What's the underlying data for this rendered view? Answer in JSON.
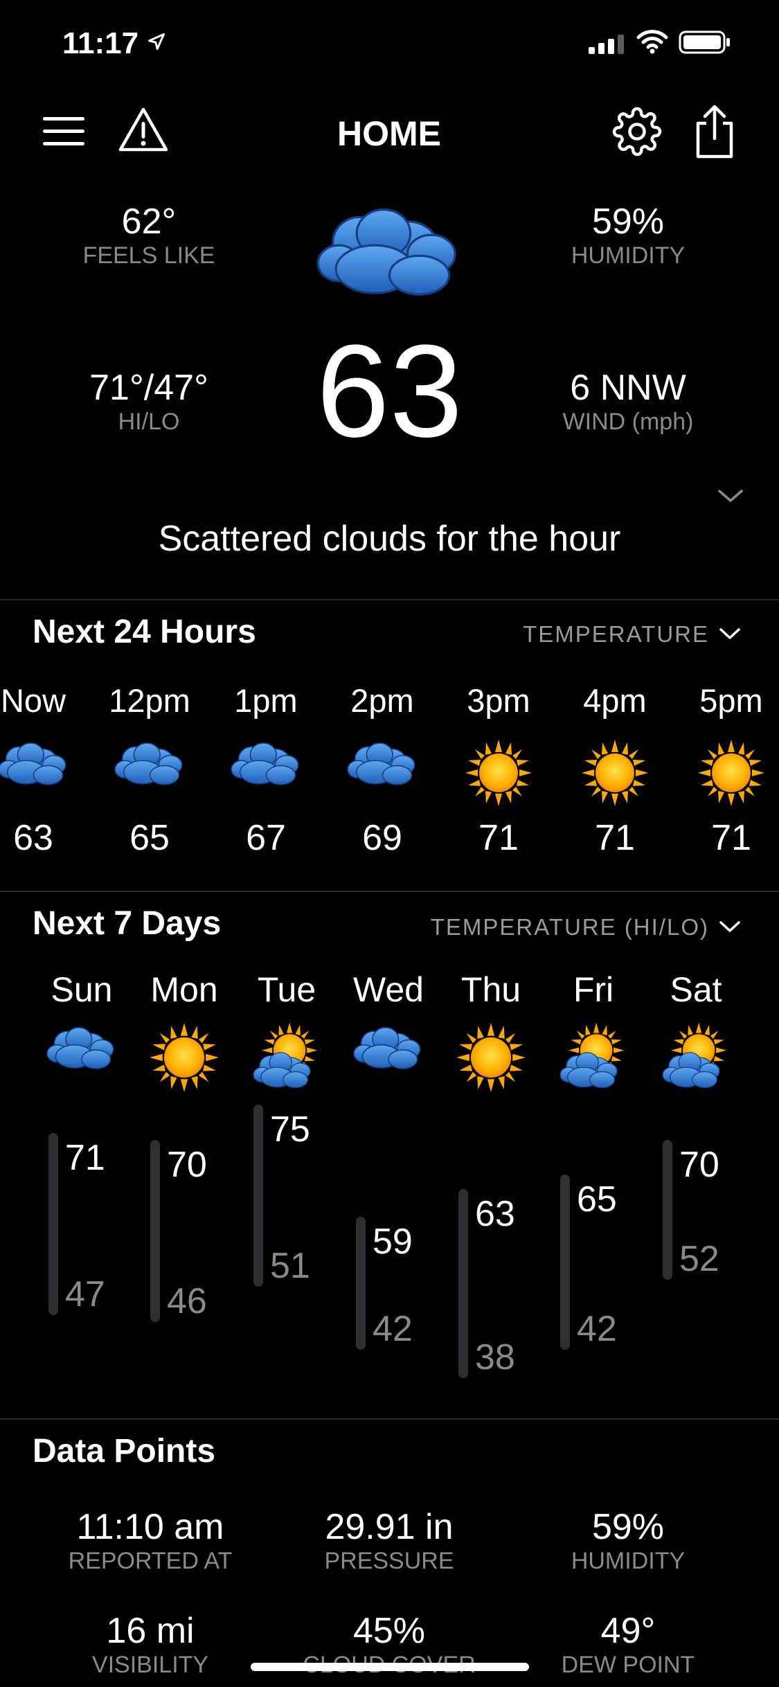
{
  "status_bar": {
    "time": "11:17"
  },
  "header": {
    "title": "HOME"
  },
  "current": {
    "feels_like": {
      "value": "62°",
      "label": "FEELS LIKE"
    },
    "humidity": {
      "value": "59%",
      "label": "HUMIDITY"
    },
    "hilo": {
      "value": "71°/47°",
      "label": "HI/LO"
    },
    "wind": {
      "value": "6 NNW",
      "label": "WIND (mph)"
    },
    "temperature": "63",
    "summary": "Scattered clouds for the hour",
    "icon": "cloudy-icon"
  },
  "hourly": {
    "title": "Next 24 Hours",
    "control": "TEMPERATURE",
    "items": [
      {
        "time": "Now",
        "temp": "63",
        "icon": "cloudy"
      },
      {
        "time": "12pm",
        "temp": "65",
        "icon": "cloudy"
      },
      {
        "time": "1pm",
        "temp": "67",
        "icon": "cloudy"
      },
      {
        "time": "2pm",
        "temp": "69",
        "icon": "cloudy"
      },
      {
        "time": "3pm",
        "temp": "71",
        "icon": "sunny"
      },
      {
        "time": "4pm",
        "temp": "71",
        "icon": "sunny"
      },
      {
        "time": "5pm",
        "temp": "71",
        "icon": "sunny"
      }
    ]
  },
  "daily": {
    "title": "Next 7 Days",
    "control": "TEMPERATURE (HI/LO)",
    "items": [
      {
        "day": "Sun",
        "hi": "71",
        "lo": "47",
        "icon": "cloudy"
      },
      {
        "day": "Mon",
        "hi": "70",
        "lo": "46",
        "icon": "sunny"
      },
      {
        "day": "Tue",
        "hi": "75",
        "lo": "51",
        "icon": "partly-cloudy"
      },
      {
        "day": "Wed",
        "hi": "59",
        "lo": "42",
        "icon": "cloudy"
      },
      {
        "day": "Thu",
        "hi": "63",
        "lo": "38",
        "icon": "sunny"
      },
      {
        "day": "Fri",
        "hi": "65",
        "lo": "42",
        "icon": "partly-cloudy"
      },
      {
        "day": "Sat",
        "hi": "70",
        "lo": "52",
        "icon": "partly-cloudy"
      }
    ]
  },
  "data_points": {
    "title": "Data Points",
    "items": [
      {
        "value": "11:10 am",
        "label": "REPORTED AT"
      },
      {
        "value": "29.91 in",
        "label": "PRESSURE"
      },
      {
        "value": "59%",
        "label": "HUMIDITY"
      },
      {
        "value": "16 mi",
        "label": "VISIBILITY"
      },
      {
        "value": "45%",
        "label": "CLOUD COVER"
      },
      {
        "value": "49°",
        "label": "DEW POINT"
      }
    ]
  },
  "colors": {
    "background": "#000000",
    "muted": "#8a8a8e",
    "cloud": "#3a7fd6",
    "sun": "#f7a400"
  }
}
